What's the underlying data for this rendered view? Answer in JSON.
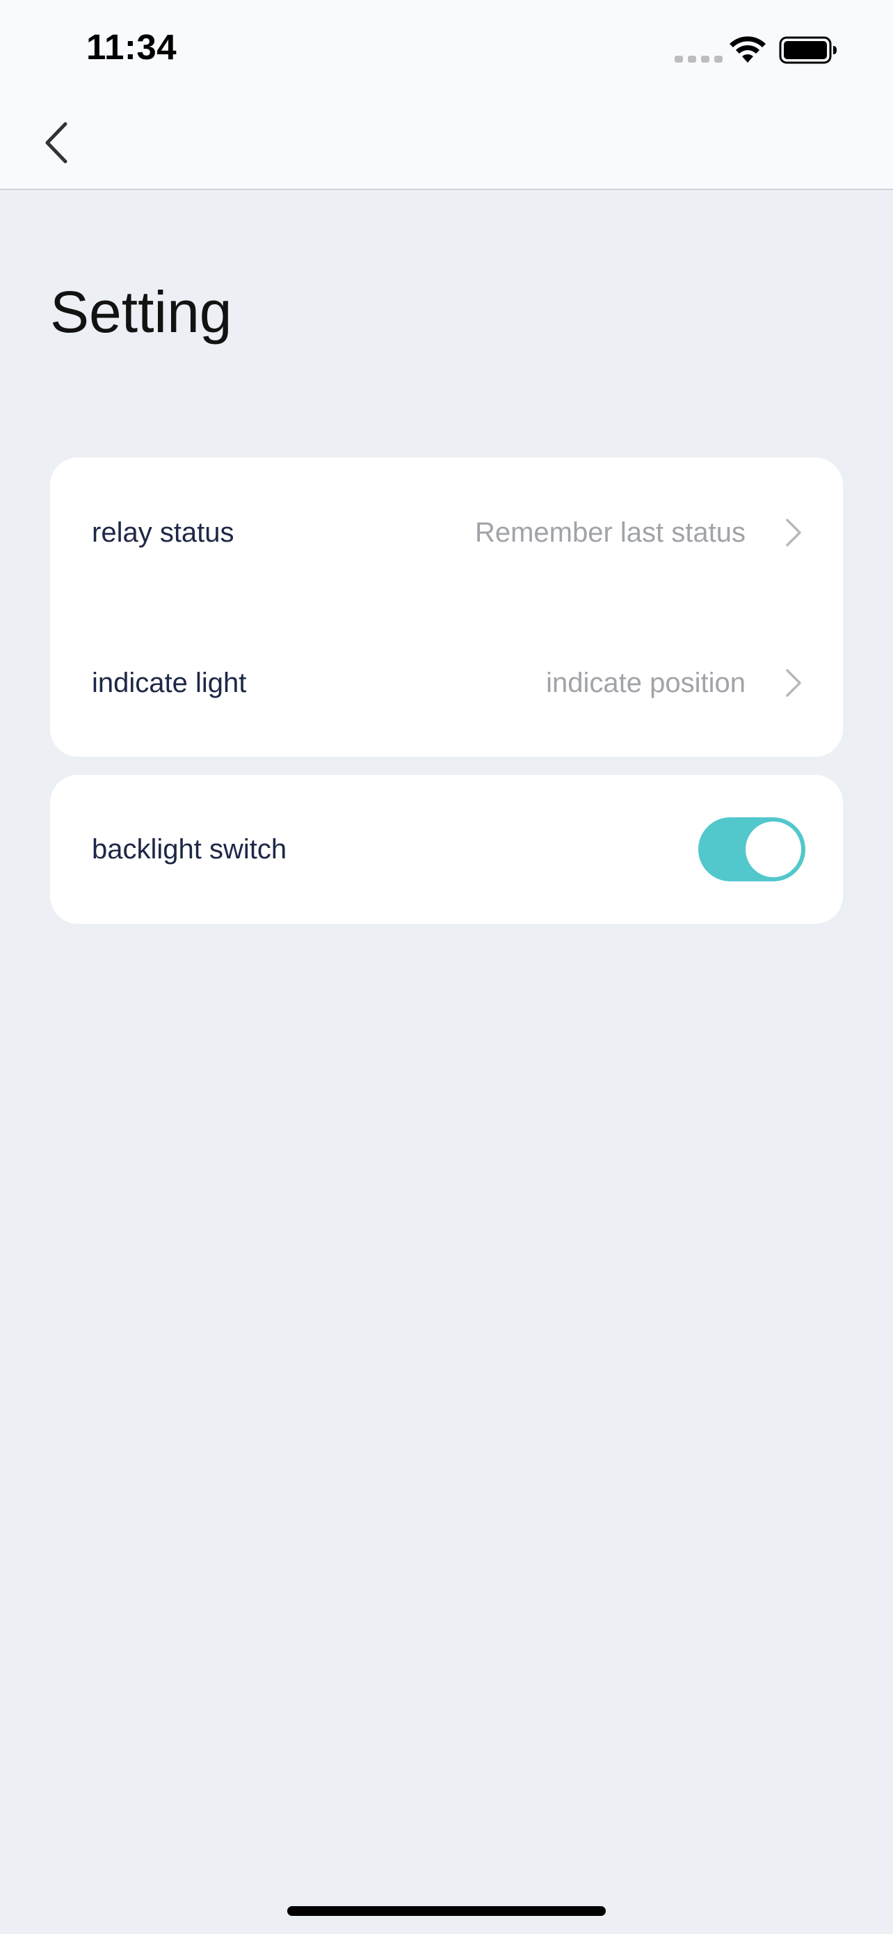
{
  "status_bar": {
    "time": "11:34"
  },
  "nav": {
    "back_icon": "chevron-left-icon"
  },
  "page": {
    "title": "Setting"
  },
  "settings": {
    "group1": [
      {
        "label": "relay status",
        "value": "Remember last status"
      },
      {
        "label": "indicate light",
        "value": "indicate position"
      }
    ],
    "group2": [
      {
        "label": "backlight switch",
        "toggle_on": true
      }
    ]
  },
  "colors": {
    "accent": "#52C7CC",
    "background": "#ECEFF4",
    "label": "#1E2746",
    "value": "#A0A3A8"
  }
}
